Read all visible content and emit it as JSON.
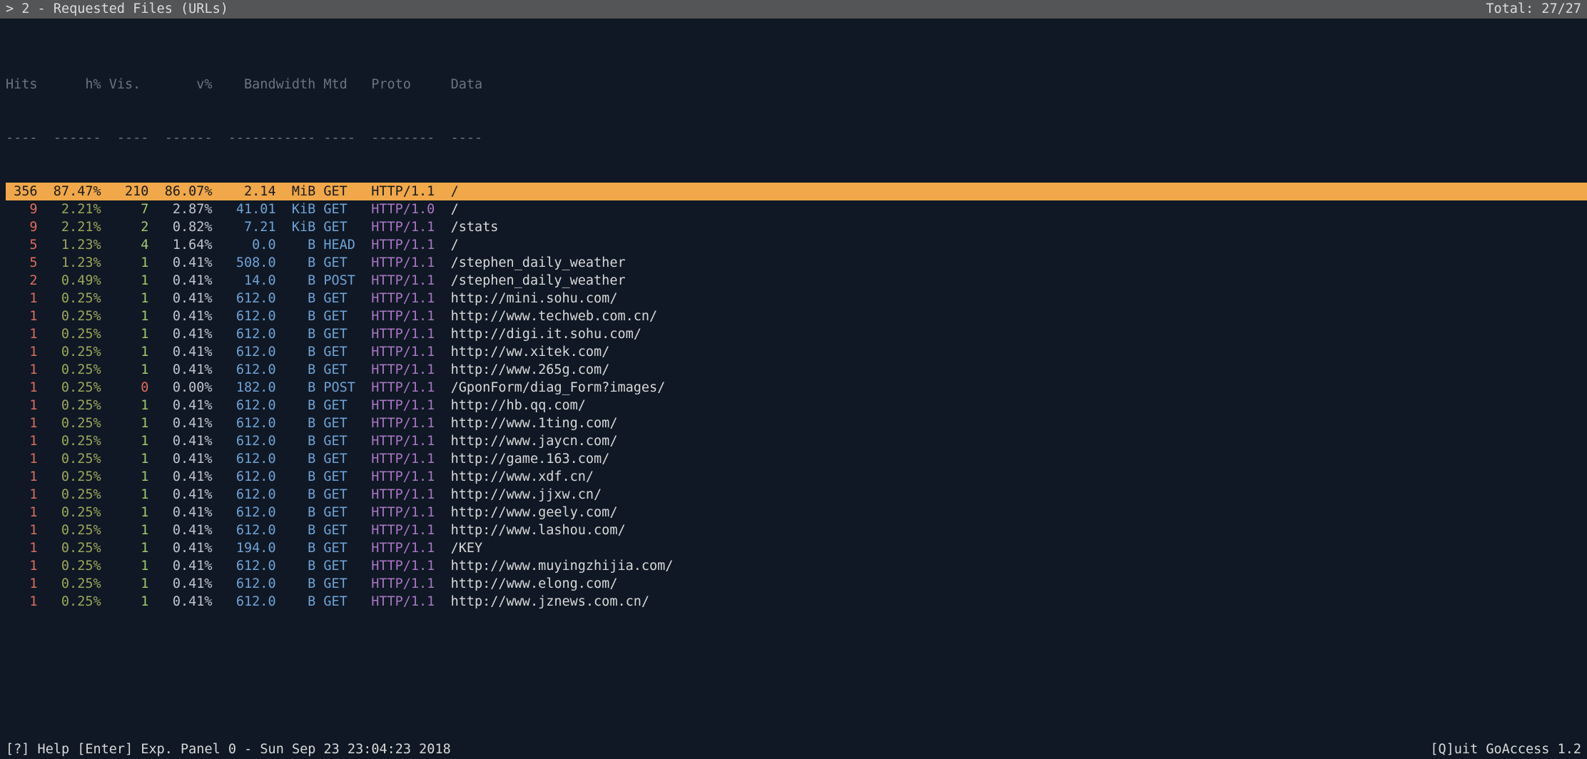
{
  "header": {
    "title": "> 2 - Requested Files (URLs)",
    "total": "Total: 27/27"
  },
  "columns": {
    "hits": "Hits",
    "hpct": "h%",
    "vis": "Vis.",
    "vpct": "v%",
    "bw": "Bandwidth",
    "mtd": "Mtd",
    "proto": "Proto",
    "data": "Data"
  },
  "dashes": {
    "hits": "----",
    "hpct": "------",
    "vis": "----",
    "vpct": "------",
    "bw": "-----------",
    "mtd": "----",
    "proto": "--------",
    "data": "----"
  },
  "rows": [
    {
      "hits": "356",
      "hpct": "87.47%",
      "vis": "210",
      "vpct": "86.07%",
      "bw": "2.14",
      "bwu": "MiB",
      "mtd": "GET",
      "proto": "HTTP/1.1",
      "data": "/",
      "selected": true
    },
    {
      "hits": "9",
      "hpct": "2.21%",
      "vis": "7",
      "vpct": "2.87%",
      "bw": "41.01",
      "bwu": "KiB",
      "mtd": "GET",
      "proto": "HTTP/1.0",
      "data": "/"
    },
    {
      "hits": "9",
      "hpct": "2.21%",
      "vis": "2",
      "vpct": "0.82%",
      "bw": "7.21",
      "bwu": "KiB",
      "mtd": "GET",
      "proto": "HTTP/1.1",
      "data": "/stats"
    },
    {
      "hits": "5",
      "hpct": "1.23%",
      "vis": "4",
      "vpct": "1.64%",
      "bw": "0.0",
      "bwu": "  B",
      "mtd": "HEAD",
      "proto": "HTTP/1.1",
      "data": "/"
    },
    {
      "hits": "5",
      "hpct": "1.23%",
      "vis": "1",
      "vpct": "0.41%",
      "bw": "508.0",
      "bwu": "  B",
      "mtd": "GET",
      "proto": "HTTP/1.1",
      "data": "/stephen_daily_weather"
    },
    {
      "hits": "2",
      "hpct": "0.49%",
      "vis": "1",
      "vpct": "0.41%",
      "bw": "14.0",
      "bwu": "  B",
      "mtd": "POST",
      "proto": "HTTP/1.1",
      "data": "/stephen_daily_weather"
    },
    {
      "hits": "1",
      "hpct": "0.25%",
      "vis": "1",
      "vpct": "0.41%",
      "bw": "612.0",
      "bwu": "  B",
      "mtd": "GET",
      "proto": "HTTP/1.1",
      "data": "http://mini.sohu.com/"
    },
    {
      "hits": "1",
      "hpct": "0.25%",
      "vis": "1",
      "vpct": "0.41%",
      "bw": "612.0",
      "bwu": "  B",
      "mtd": "GET",
      "proto": "HTTP/1.1",
      "data": "http://www.techweb.com.cn/"
    },
    {
      "hits": "1",
      "hpct": "0.25%",
      "vis": "1",
      "vpct": "0.41%",
      "bw": "612.0",
      "bwu": "  B",
      "mtd": "GET",
      "proto": "HTTP/1.1",
      "data": "http://digi.it.sohu.com/"
    },
    {
      "hits": "1",
      "hpct": "0.25%",
      "vis": "1",
      "vpct": "0.41%",
      "bw": "612.0",
      "bwu": "  B",
      "mtd": "GET",
      "proto": "HTTP/1.1",
      "data": "http://ww.xitek.com/"
    },
    {
      "hits": "1",
      "hpct": "0.25%",
      "vis": "1",
      "vpct": "0.41%",
      "bw": "612.0",
      "bwu": "  B",
      "mtd": "GET",
      "proto": "HTTP/1.1",
      "data": "http://www.265g.com/"
    },
    {
      "hits": "1",
      "hpct": "0.25%",
      "vis": "0",
      "vpct": "0.00%",
      "bw": "182.0",
      "bwu": "  B",
      "mtd": "POST",
      "proto": "HTTP/1.1",
      "data": "/GponForm/diag_Form?images/",
      "viszero": true
    },
    {
      "hits": "1",
      "hpct": "0.25%",
      "vis": "1",
      "vpct": "0.41%",
      "bw": "612.0",
      "bwu": "  B",
      "mtd": "GET",
      "proto": "HTTP/1.1",
      "data": "http://hb.qq.com/"
    },
    {
      "hits": "1",
      "hpct": "0.25%",
      "vis": "1",
      "vpct": "0.41%",
      "bw": "612.0",
      "bwu": "  B",
      "mtd": "GET",
      "proto": "HTTP/1.1",
      "data": "http://www.1ting.com/"
    },
    {
      "hits": "1",
      "hpct": "0.25%",
      "vis": "1",
      "vpct": "0.41%",
      "bw": "612.0",
      "bwu": "  B",
      "mtd": "GET",
      "proto": "HTTP/1.1",
      "data": "http://www.jaycn.com/"
    },
    {
      "hits": "1",
      "hpct": "0.25%",
      "vis": "1",
      "vpct": "0.41%",
      "bw": "612.0",
      "bwu": "  B",
      "mtd": "GET",
      "proto": "HTTP/1.1",
      "data": "http://game.163.com/"
    },
    {
      "hits": "1",
      "hpct": "0.25%",
      "vis": "1",
      "vpct": "0.41%",
      "bw": "612.0",
      "bwu": "  B",
      "mtd": "GET",
      "proto": "HTTP/1.1",
      "data": "http://www.xdf.cn/"
    },
    {
      "hits": "1",
      "hpct": "0.25%",
      "vis": "1",
      "vpct": "0.41%",
      "bw": "612.0",
      "bwu": "  B",
      "mtd": "GET",
      "proto": "HTTP/1.1",
      "data": "http://www.jjxw.cn/"
    },
    {
      "hits": "1",
      "hpct": "0.25%",
      "vis": "1",
      "vpct": "0.41%",
      "bw": "612.0",
      "bwu": "  B",
      "mtd": "GET",
      "proto": "HTTP/1.1",
      "data": "http://www.geely.com/"
    },
    {
      "hits": "1",
      "hpct": "0.25%",
      "vis": "1",
      "vpct": "0.41%",
      "bw": "612.0",
      "bwu": "  B",
      "mtd": "GET",
      "proto": "HTTP/1.1",
      "data": "http://www.lashou.com/"
    },
    {
      "hits": "1",
      "hpct": "0.25%",
      "vis": "1",
      "vpct": "0.41%",
      "bw": "194.0",
      "bwu": "  B",
      "mtd": "GET",
      "proto": "HTTP/1.1",
      "data": "/KEY"
    },
    {
      "hits": "1",
      "hpct": "0.25%",
      "vis": "1",
      "vpct": "0.41%",
      "bw": "612.0",
      "bwu": "  B",
      "mtd": "GET",
      "proto": "HTTP/1.1",
      "data": "http://www.muyingzhijia.com/"
    },
    {
      "hits": "1",
      "hpct": "0.25%",
      "vis": "1",
      "vpct": "0.41%",
      "bw": "612.0",
      "bwu": "  B",
      "mtd": "GET",
      "proto": "HTTP/1.1",
      "data": "http://www.elong.com/"
    },
    {
      "hits": "1",
      "hpct": "0.25%",
      "vis": "1",
      "vpct": "0.41%",
      "bw": "612.0",
      "bwu": "  B",
      "mtd": "GET",
      "proto": "HTTP/1.1",
      "data": "http://www.jznews.com.cn/"
    }
  ],
  "footer": {
    "left": "[?] Help [Enter] Exp. Panel  0 - Sun Sep 23 23:04:23 2018",
    "right": "[Q]uit GoAccess 1.2"
  }
}
